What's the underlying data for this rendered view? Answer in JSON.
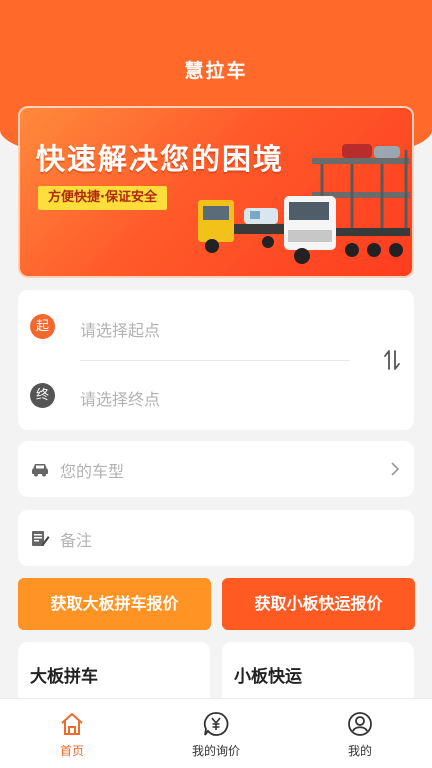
{
  "app": {
    "title": "慧拉车"
  },
  "banner": {
    "title": "快速解决您的困境",
    "subtitle": "方便快捷·保证安全"
  },
  "route": {
    "start_badge": "起",
    "start_placeholder": "请选择起点",
    "end_badge": "终",
    "end_placeholder": "请选择终点"
  },
  "vehicle": {
    "placeholder": "您的车型"
  },
  "notes": {
    "placeholder": "备注"
  },
  "actions": {
    "large_quote": "获取大板拼车报价",
    "small_quote": "获取小板快运报价"
  },
  "sections": {
    "left_title": "大板拼车",
    "right_title": "小板快运"
  },
  "tabbar": [
    {
      "label": "首页",
      "icon": "home-icon",
      "active": true
    },
    {
      "label": "我的询价",
      "icon": "yen-chat-icon",
      "active": false
    },
    {
      "label": "我的",
      "icon": "user-icon",
      "active": false
    }
  ],
  "colors": {
    "brand": "#ff6a2a",
    "accent_orange": "#ff9323",
    "accent_red": "#ff5a22"
  }
}
